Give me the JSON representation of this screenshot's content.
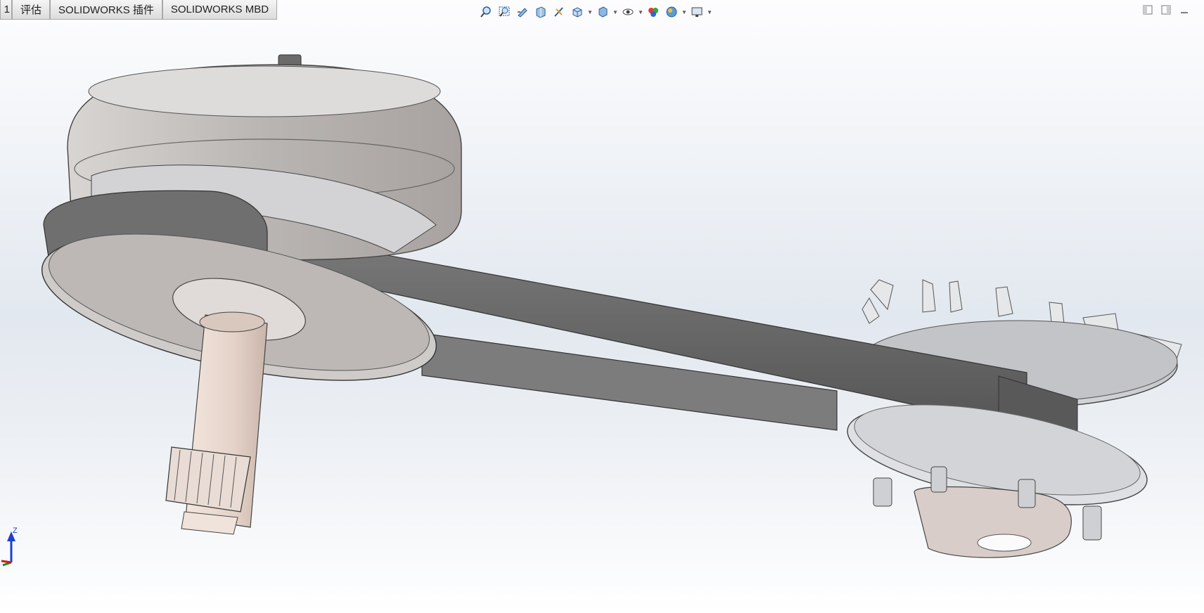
{
  "command_manager": {
    "tabs": [
      {
        "id": "partial",
        "label": "1"
      },
      {
        "id": "evaluate",
        "label": "评估"
      },
      {
        "id": "addins",
        "label": "SOLIDWORKS 插件"
      },
      {
        "id": "mbd",
        "label": "SOLIDWORKS MBD"
      }
    ]
  },
  "heads_up_toolbar": {
    "items": [
      "zoom-to-fit-icon",
      "zoom-to-area-icon",
      "previous-view-icon",
      "section-view-icon",
      "dynamic-annotation-icon",
      "view-orientation-icon",
      "display-style-icon",
      "hide-show-items-icon",
      "edit-appearance-icon",
      "apply-scene-icon",
      "view-settings-icon"
    ]
  },
  "triad": {
    "axis_z": "Z"
  },
  "colors": {
    "belt": "#6e6e6e",
    "pulley": "#c9c6c4",
    "shaft": "#eadbd2",
    "fan": "#dfe0e2",
    "background_top": "#fdfdfe",
    "background_mid": "#e2e8ef"
  }
}
